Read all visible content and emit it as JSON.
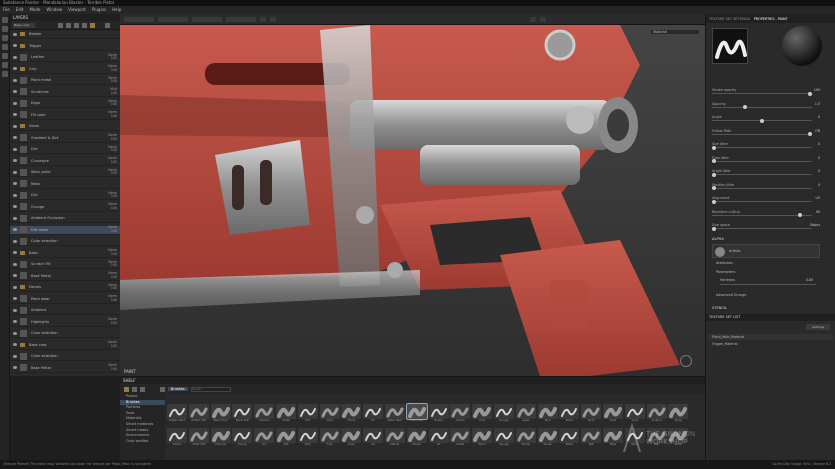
{
  "title": "Substance Painter - Mandalorian Blaster - Terrible Pistol",
  "menu": [
    "File",
    "Edit",
    "Mode",
    "Window",
    "Viewport",
    "Plugins",
    "Help"
  ],
  "layers": {
    "header": "LAYERS",
    "blend": "Base color",
    "rows": [
      {
        "name": "Blaster",
        "mode": "",
        "folder": true,
        "sel": false
      },
      {
        "name": "Trigger",
        "mode": "",
        "folder": true,
        "sel": false
      },
      {
        "name": "Leather",
        "mode": "Norm\n100",
        "folder": false,
        "sel": false
      },
      {
        "name": "Grip",
        "mode": "Norm\n100",
        "folder": true,
        "sel": false
      },
      {
        "name": "Paint metal",
        "mode": "Norm\n100",
        "folder": false,
        "sel": false
      },
      {
        "name": "Scratches",
        "mode": "Mult\n100",
        "folder": false,
        "sel": false
      },
      {
        "name": "Edge",
        "mode": "Norm\n100",
        "folder": false,
        "sel": false
      },
      {
        "name": "Fill color",
        "mode": "Norm\n100",
        "folder": false,
        "sel": false
      },
      {
        "name": "Seam",
        "mode": "",
        "folder": true,
        "sel": false
      },
      {
        "name": "Gradient & Dirt",
        "mode": "Norm\n100",
        "folder": false,
        "sel": false
      },
      {
        "name": "Dirt",
        "mode": "Norm\n100",
        "folder": false,
        "sel": false
      },
      {
        "name": "Curvature",
        "mode": "Norm\n100",
        "folder": false,
        "sel": false
      },
      {
        "name": "Worn paint",
        "mode": "Norm\n100",
        "folder": false,
        "sel": false
      },
      {
        "name": "Mask",
        "mode": "",
        "folder": false,
        "sel": false
      },
      {
        "name": "Dirt",
        "mode": "Norm\n100",
        "folder": false,
        "sel": false
      },
      {
        "name": "Grunge",
        "mode": "Norm\n100",
        "folder": false,
        "sel": false
      },
      {
        "name": "Ambient Occlusion",
        "mode": "",
        "folder": false,
        "sel": false
      },
      {
        "name": "Dirt mask",
        "mode": "Norm\n100",
        "folder": false,
        "sel": true
      },
      {
        "name": "Color selection",
        "mode": "",
        "folder": false,
        "sel": false
      },
      {
        "name": "Base",
        "mode": "Norm\n100",
        "folder": true,
        "sel": false
      },
      {
        "name": "Scratch Fill",
        "mode": "Norm\n100",
        "folder": false,
        "sel": false
      },
      {
        "name": "Base Metal",
        "mode": "Norm\n100",
        "folder": false,
        "sel": false
      },
      {
        "name": "Decals",
        "mode": "Norm\n100",
        "folder": true,
        "sel": false
      },
      {
        "name": "Paint wear",
        "mode": "Norm\n100",
        "folder": false,
        "sel": false
      },
      {
        "name": "Ambient",
        "mode": "",
        "folder": false,
        "sel": false
      },
      {
        "name": "Highlights",
        "mode": "Norm\n100",
        "folder": false,
        "sel": false
      },
      {
        "name": "Color selection",
        "mode": "",
        "folder": false,
        "sel": false
      },
      {
        "name": "Base coat",
        "mode": "Norm\n100",
        "folder": true,
        "sel": false
      },
      {
        "name": "Color selection",
        "mode": "",
        "folder": false,
        "sel": false
      },
      {
        "name": "Base Metal",
        "mode": "Norm\n100",
        "folder": false,
        "sel": false
      }
    ]
  },
  "viewport": {
    "label": "PAINT",
    "mode": "Material"
  },
  "shelf": {
    "header": "SHELF",
    "search_placeholder": "Search...",
    "filter": "Brushes",
    "categories": [
      "Project",
      "Brushes",
      "Particles",
      "Tools",
      "Materials",
      "Smart materials",
      "Smart masks",
      "Environments",
      "Color profiles"
    ],
    "selected_category": 1,
    "brushes": [
      "Artistic Hard",
      "Artistic Soft",
      "Basic Hard",
      "Basic Soft",
      "Cement",
      "Chalk",
      "Dirt",
      "Dust",
      "Fibers",
      "Fur",
      "Basic Hard",
      "Basic Soft",
      "Bristle",
      "Cracks",
      "Dots",
      "Grunge",
      "Leaks",
      "Mud",
      "Noise",
      "Paint",
      "Rust",
      "Sand",
      "Scratch",
      "Spray",
      "Artistic",
      "Chalk Soft",
      "Charcoal",
      "Crayon",
      "Dry",
      "Felt",
      "Fiber",
      "Flow",
      "Grain",
      "Ink",
      "Marker",
      "Mosaic",
      "Oil",
      "Pastel",
      "Pencil",
      "Sponge",
      "Stamp",
      "Stroke",
      "Water",
      "Wet",
      "Wipe",
      "Wood",
      "Hair",
      "Stitch"
    ],
    "selected_brush": 11
  },
  "properties": {
    "tabs": [
      "TEXTURE SET SETTINGS",
      "PROPERTIES - PAINT"
    ],
    "sliders": [
      {
        "label": "Stroke opacity",
        "value": "100"
      },
      {
        "label": "Spacing",
        "value": "1.5"
      },
      {
        "label": "Angle",
        "value": "0"
      },
      {
        "label": "Follow Path",
        "value": "Off"
      },
      {
        "label": "Size Jitter",
        "value": "0"
      },
      {
        "label": "Flow Jitter",
        "value": "0"
      },
      {
        "label": "Angle Jitter",
        "value": "0"
      },
      {
        "label": "Position Jitter",
        "value": "0"
      },
      {
        "label": "Alignment",
        "value": "UV"
      },
      {
        "label": "Backface culling",
        "value": "90"
      },
      {
        "label": "Size space",
        "value": "Object"
      }
    ],
    "alpha_label": "ALPHA",
    "alpha_name": "Artistic",
    "attributes_label": "Attributes",
    "parameters_label": "Parameters",
    "hardness_label": "Hardness",
    "hardness_value": "0.85",
    "advanced_label": "Advanced Grunge",
    "stencil_label": "STENCIL",
    "texture_label": "TEXTURE SET LIST",
    "tex_items": [
      "Pistol_Main_Material",
      "Trigger_Material"
    ],
    "settings_label": "Settings"
  },
  "status": "[Texture Painter] The mesh map 'Ambient occlusion' for texture set 'Pistol_Main' is not baked",
  "status_right": "Cache Disk Usage:  94% | Version 6.2",
  "watermark": "THE GNOMON WORKSHOP",
  "colors": {
    "accent": "#3c4a5c",
    "paint_red": "#b5483e",
    "metal": "#9a9a9a"
  }
}
